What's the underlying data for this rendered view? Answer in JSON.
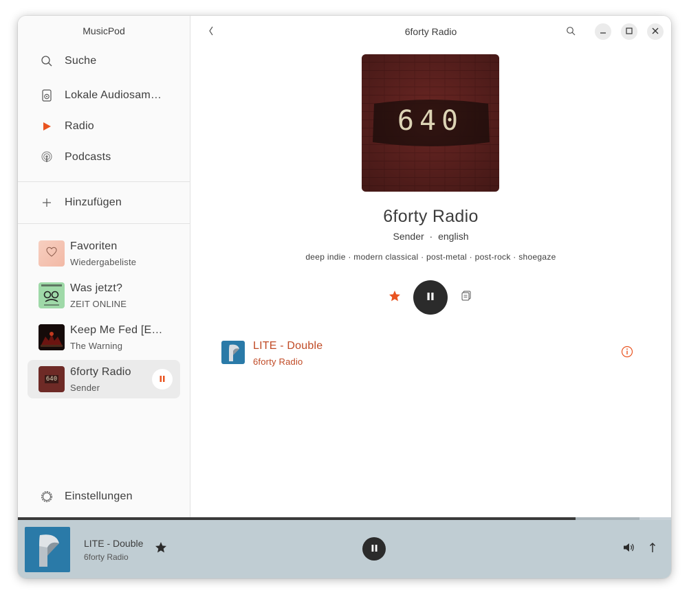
{
  "app": {
    "title": "MusicPod"
  },
  "sidebar": {
    "nav": [
      {
        "label": "Suche",
        "icon": "search-icon"
      },
      {
        "label": "Lokale Audiosammlung",
        "icon": "local-audio-icon"
      },
      {
        "label": "Radio",
        "icon": "radio-play-icon"
      },
      {
        "label": "Podcasts",
        "icon": "podcast-icon"
      }
    ],
    "add_label": "Hinzufügen",
    "playlists": [
      {
        "title": "Favoriten",
        "subtitle": "Wiedergabeliste"
      },
      {
        "title": "Was jetzt?",
        "subtitle": "ZEIT ONLINE"
      },
      {
        "title": "Keep Me Fed [Explicit]",
        "subtitle": "The Warning"
      },
      {
        "title": "6forty Radio",
        "subtitle": "Sender"
      }
    ],
    "settings_label": "Einstellungen"
  },
  "header": {
    "title": "6forty Radio"
  },
  "station": {
    "cover_text": "640",
    "name": "6forty Radio",
    "type": "Sender",
    "sep": "·",
    "language": "english",
    "tags": "deep indie · modern classical · post-metal · post-rock · shoegaze"
  },
  "track": {
    "title": "LITE - Double",
    "station": "6forty Radio"
  },
  "player": {
    "title": "LITE - Double",
    "subtitle": "6forty Radio",
    "progress": 0.8535,
    "buffered": 0.9515
  },
  "colors": {
    "accent": "#e95420",
    "track_text": "#c04a25",
    "player_bg": "#c0cdd3",
    "dark_button": "#2b2b2b"
  }
}
